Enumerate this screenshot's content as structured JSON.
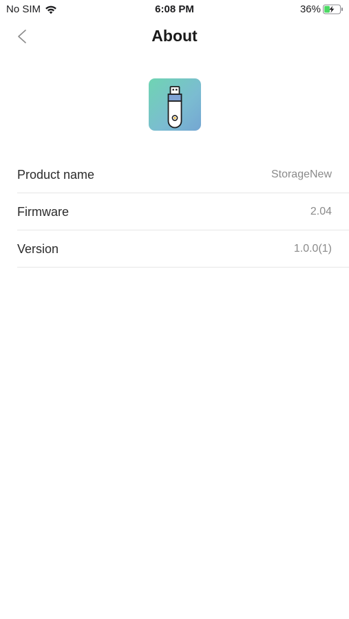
{
  "status_bar": {
    "carrier": "No SIM",
    "time": "6:08 PM",
    "battery_percent": "36%",
    "battery_level": 0.36,
    "charging": true,
    "icons": [
      "wifi-icon",
      "battery-icon",
      "charging-bolt-icon"
    ]
  },
  "nav": {
    "title": "About",
    "back_icon": "chevron-left-icon"
  },
  "app_icon": {
    "name": "usb-drive-icon",
    "gradient": [
      "#6fd4b2",
      "#74a6d2"
    ]
  },
  "info": {
    "rows": [
      {
        "label": "Product name",
        "value": "StorageNew"
      },
      {
        "label": "Firmware",
        "value": "2.04"
      },
      {
        "label": "Version",
        "value": "1.0.0(1)"
      }
    ]
  },
  "colors": {
    "label": "#2b2b2b",
    "value": "#8a8a8a",
    "divider": "#e6e6e6",
    "charging": "#4cd964"
  }
}
